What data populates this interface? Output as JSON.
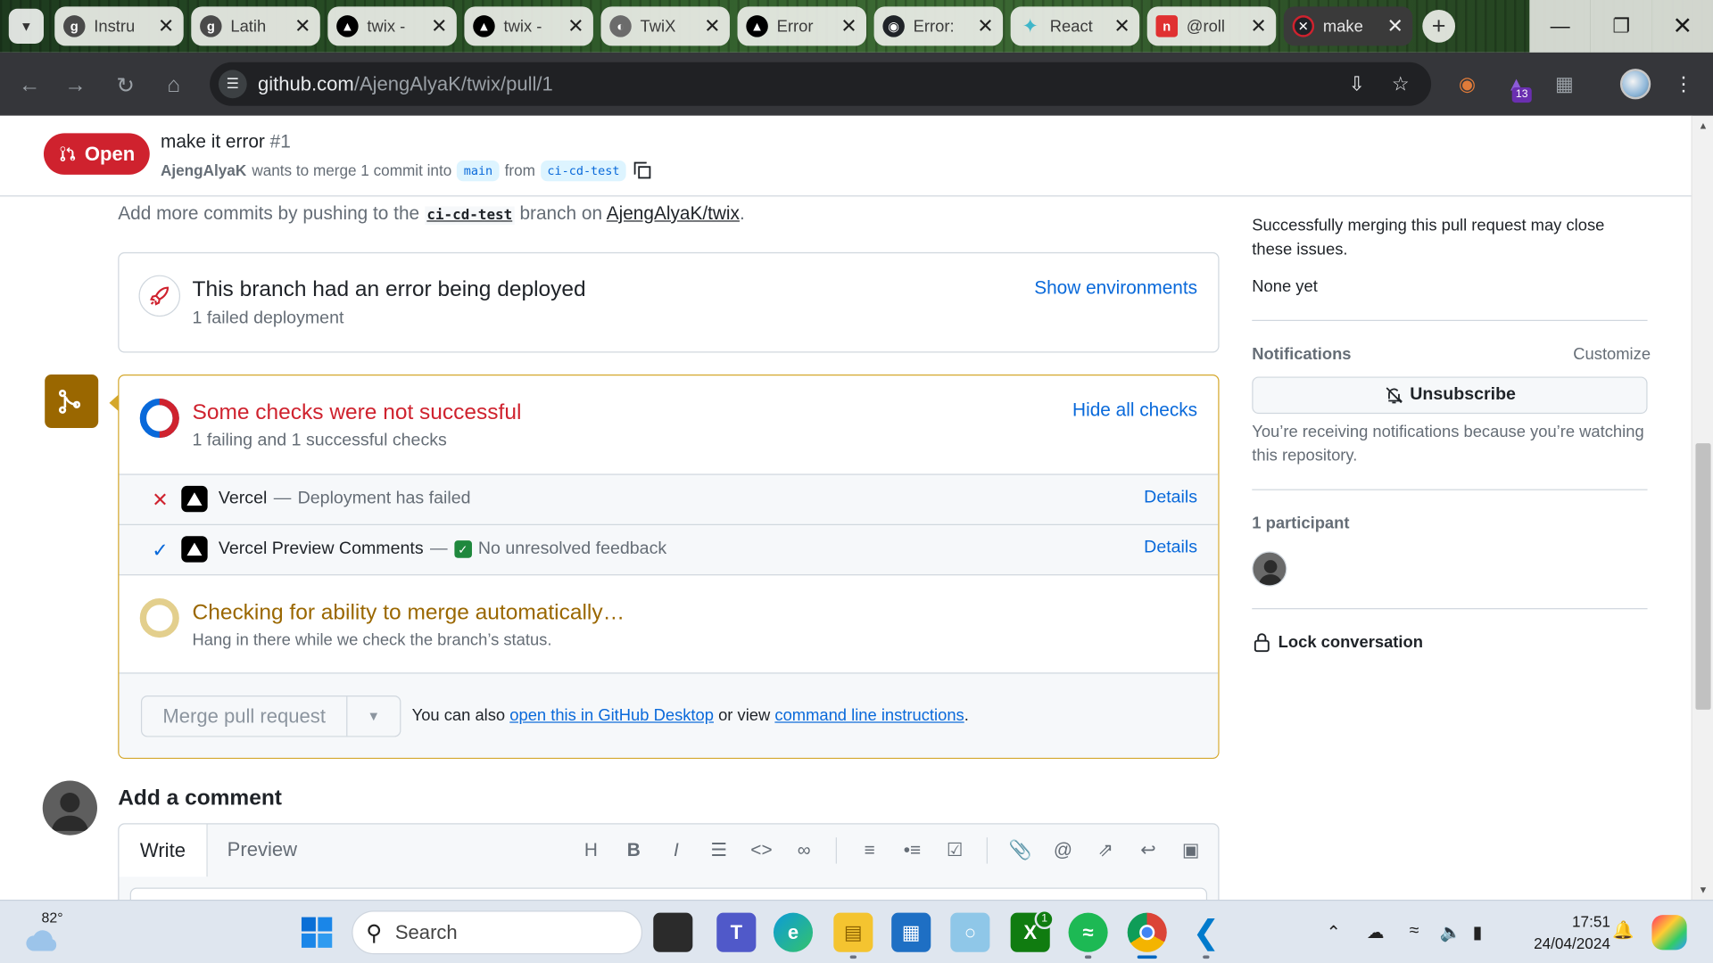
{
  "browser": {
    "tabs": [
      {
        "title": "Instru",
        "icon": "g-icon",
        "color": "#4a4a4a"
      },
      {
        "title": "Latih",
        "icon": "g-icon",
        "color": "#4a4a4a"
      },
      {
        "title": "twix -",
        "icon": "vercel-icon",
        "color": "#000000"
      },
      {
        "title": "twix -",
        "icon": "vercel-icon",
        "color": "#000000"
      },
      {
        "title": "TwiX",
        "icon": "globe-icon",
        "color": "#6b6b6b"
      },
      {
        "title": "Error",
        "icon": "vercel-icon",
        "color": "#000000"
      },
      {
        "title": "Error:",
        "icon": "github-icon",
        "color": "#1f2328"
      },
      {
        "title": "React",
        "icon": "sparkle-icon",
        "color": "#3fb6c9"
      },
      {
        "title": "@roll",
        "icon": "notion-icon",
        "color": "#e03131"
      },
      {
        "title": "make",
        "icon": "github-error-icon",
        "color": "#cf222e"
      }
    ],
    "url_host": "github.com",
    "url_path": "/AjengAlyaK/twix/pull/1",
    "extension_badge": "13"
  },
  "pr": {
    "state_label": "Open",
    "title": "make it error",
    "number": "#1",
    "author": "AjengAlyaK",
    "meta_text": "wants to merge 1 commit into",
    "base_branch": "main",
    "from_text": "from",
    "head_branch": "ci-cd-test"
  },
  "hint": {
    "prefix": "Add more commits by pushing to the",
    "branch": "ci-cd-test",
    "middle": "branch on",
    "repo": "AjengAlyaK/twix",
    "suffix": "."
  },
  "deployment": {
    "title": "This branch had an error being deployed",
    "subtitle": "1 failed deployment",
    "action": "Show environments"
  },
  "checks": {
    "title": "Some checks were not successful",
    "subtitle": "1 failing and 1 successful checks",
    "action": "Hide all checks",
    "items": [
      {
        "name": "Vercel",
        "separator": "—",
        "description": "Deployment has failed",
        "status": "failed",
        "details": "Details"
      },
      {
        "name": "Vercel Preview Comments",
        "separator": "—",
        "description": "No unresolved feedback",
        "status": "success",
        "details": "Details"
      }
    ]
  },
  "mergeability": {
    "title": "Checking for ability to merge automatically…",
    "subtitle": "Hang in there while we check the branch’s status."
  },
  "merge": {
    "button_label": "Merge pull request",
    "also_prefix": "You can also",
    "desktop_link": "open this in GitHub Desktop",
    "or_text": "or view",
    "cli_link": "command line instructions",
    "suffix": "."
  },
  "comment": {
    "heading": "Add a comment",
    "tab_write": "Write",
    "tab_preview": "Preview"
  },
  "sidebar": {
    "issues_text": "Successfully merging this pull request may close these issues.",
    "issues_value": "None yet",
    "notifications_heading": "Notifications",
    "customize": "Customize",
    "unsubscribe": "Unsubscribe",
    "notifications_reason": "You’re receiving notifications because you’re watching this repository.",
    "participants": "1 participant",
    "lock": "Lock conversation"
  },
  "taskbar": {
    "temperature": "82°",
    "search_placeholder": "Search",
    "xbox_badge": "1",
    "time": "17:51",
    "date": "24/04/2024"
  },
  "colors": {
    "danger": "#cf222e",
    "accent": "#0969da",
    "attention": "#9a6700",
    "success": "#1f883d"
  }
}
